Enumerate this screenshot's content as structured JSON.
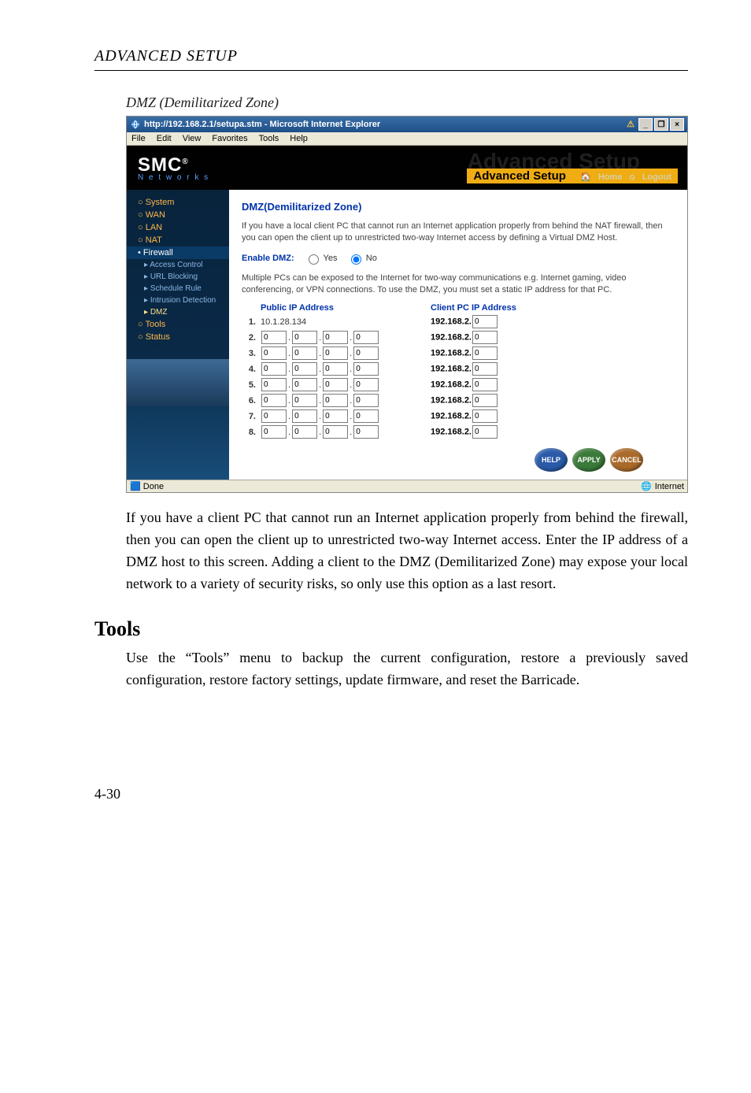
{
  "page_header": "ADVANCED SETUP",
  "sub_heading": "DMZ (Demilitarized Zone)",
  "screenshot": {
    "titlebar": {
      "text": "http://192.168.2.1/setupa.stm - Microsoft Internet Explorer"
    },
    "menubar": [
      "File",
      "Edit",
      "View",
      "Favorites",
      "Tools",
      "Help"
    ],
    "banner": {
      "logo_main": "SMC",
      "logo_reg": "®",
      "logo_sub": "N e t w o r k s",
      "bg_text": "Advanced Setup",
      "bar_text": "Advanced Setup",
      "home": "Home",
      "logout": "Logout"
    },
    "sidebar": {
      "items": [
        {
          "label": "System",
          "type": "top"
        },
        {
          "label": "WAN",
          "type": "top"
        },
        {
          "label": "LAN",
          "type": "top"
        },
        {
          "label": "NAT",
          "type": "top"
        },
        {
          "label": "Firewall",
          "type": "active-top"
        },
        {
          "label": "Access Control",
          "type": "sub"
        },
        {
          "label": "URL Blocking",
          "type": "sub"
        },
        {
          "label": "Schedule Rule",
          "type": "sub"
        },
        {
          "label": "Intrusion Detection",
          "type": "sub"
        },
        {
          "label": "DMZ",
          "type": "sub active"
        },
        {
          "label": "Tools",
          "type": "top"
        },
        {
          "label": "Status",
          "type": "top"
        }
      ]
    },
    "content": {
      "title": "DMZ(Demilitarized Zone)",
      "para1": "If you have a local client PC that cannot run an Internet application properly from behind the NAT firewall, then you can open the client up to unrestricted two-way Internet access by defining a Virtual DMZ Host.",
      "enable_label": "Enable DMZ:",
      "yes": "Yes",
      "no": "No",
      "para2": "Multiple PCs can be exposed to the Internet for two-way communications e.g. Internet gaming, video conferencing, or VPN connections.  To use the DMZ, you must set a static IP address for that PC.",
      "public_head": "Public IP Address",
      "client_head": "Client PC IP Address",
      "rows": [
        {
          "n": "1.",
          "public_static": "10.1.28.134",
          "client_prefix": "192.168.2.",
          "client_last": "0"
        },
        {
          "n": "2.",
          "p": [
            "0",
            "0",
            "0",
            "0"
          ],
          "client_prefix": "192.168.2.",
          "client_last": "0"
        },
        {
          "n": "3.",
          "p": [
            "0",
            "0",
            "0",
            "0"
          ],
          "client_prefix": "192.168.2.",
          "client_last": "0"
        },
        {
          "n": "4.",
          "p": [
            "0",
            "0",
            "0",
            "0"
          ],
          "client_prefix": "192.168.2.",
          "client_last": "0"
        },
        {
          "n": "5.",
          "p": [
            "0",
            "0",
            "0",
            "0"
          ],
          "client_prefix": "192.168.2.",
          "client_last": "0"
        },
        {
          "n": "6.",
          "p": [
            "0",
            "0",
            "0",
            "0"
          ],
          "client_prefix": "192.168.2.",
          "client_last": "0"
        },
        {
          "n": "7.",
          "p": [
            "0",
            "0",
            "0",
            "0"
          ],
          "client_prefix": "192.168.2.",
          "client_last": "0"
        },
        {
          "n": "8.",
          "p": [
            "0",
            "0",
            "0",
            "0"
          ],
          "client_prefix": "192.168.2.",
          "client_last": "0"
        }
      ],
      "buttons": {
        "help": "HELP",
        "apply": "APPLY",
        "cancel": "CANCEL"
      }
    },
    "statusbar": {
      "done": "Done",
      "zone": "Internet"
    }
  },
  "para_after": "If you have a client PC that cannot run an Internet application properly from behind the firewall, then you can open the client up to unrestricted two-way Internet access. Enter the IP address of a DMZ host to this screen. Adding a client to the DMZ (Demilitarized Zone) may expose your local network to a variety of security risks, so only use this option as a last resort.",
  "tools_heading": "Tools",
  "tools_para": "Use the “Tools” menu to backup the current configuration, restore a previously saved configuration, restore factory settings, update firmware, and reset the Barricade.",
  "page_number": "4-30"
}
